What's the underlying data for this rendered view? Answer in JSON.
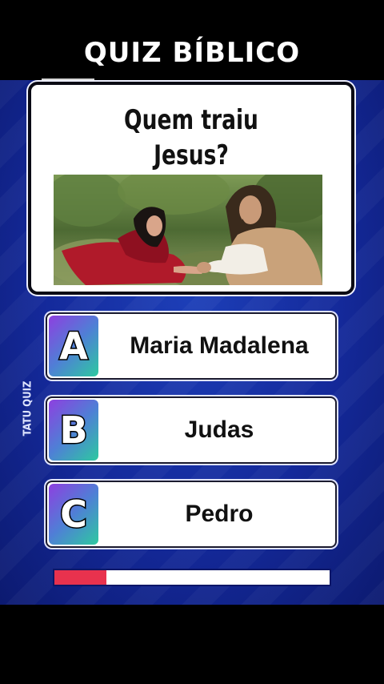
{
  "app": {
    "title": "QUIZ BÍBLICO",
    "watermark": "TATU QUIZ"
  },
  "question": {
    "line1": "Quem traiu",
    "line2": "Jesus?"
  },
  "options": [
    {
      "letter": "A",
      "text": "Maria Madalena"
    },
    {
      "letter": "B",
      "text": "Judas"
    },
    {
      "letter": "C",
      "text": "Pedro"
    }
  ],
  "timer": {
    "progress": 0.19
  },
  "colors": {
    "background": "#14299a",
    "timer_fill": "#e8324e",
    "badge_gradient_start": "#8e3fe0",
    "badge_gradient_end": "#2ec9a0"
  }
}
